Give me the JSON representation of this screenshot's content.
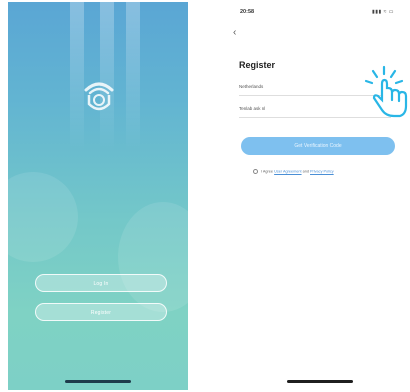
{
  "left_screen": {
    "login_button": "Log In",
    "register_button": "Register",
    "icons": [
      "app-logo-icon"
    ]
  },
  "right_screen": {
    "status_time": "20:58",
    "status_icons": "▮▮▮ ≈ ▭",
    "back_icon": "‹",
    "title": "Register",
    "country_field": "Netherlands",
    "account_field": "Tenlab ask nl",
    "verify_button": "Get Verification Code",
    "agree_prefix": "I Agree",
    "user_agreement": "User Agreement",
    "and_text": "and",
    "privacy_policy": "Privacy Policy"
  },
  "annotation": {
    "icon": "tap-hand-icon",
    "color": "#29b6e6"
  }
}
